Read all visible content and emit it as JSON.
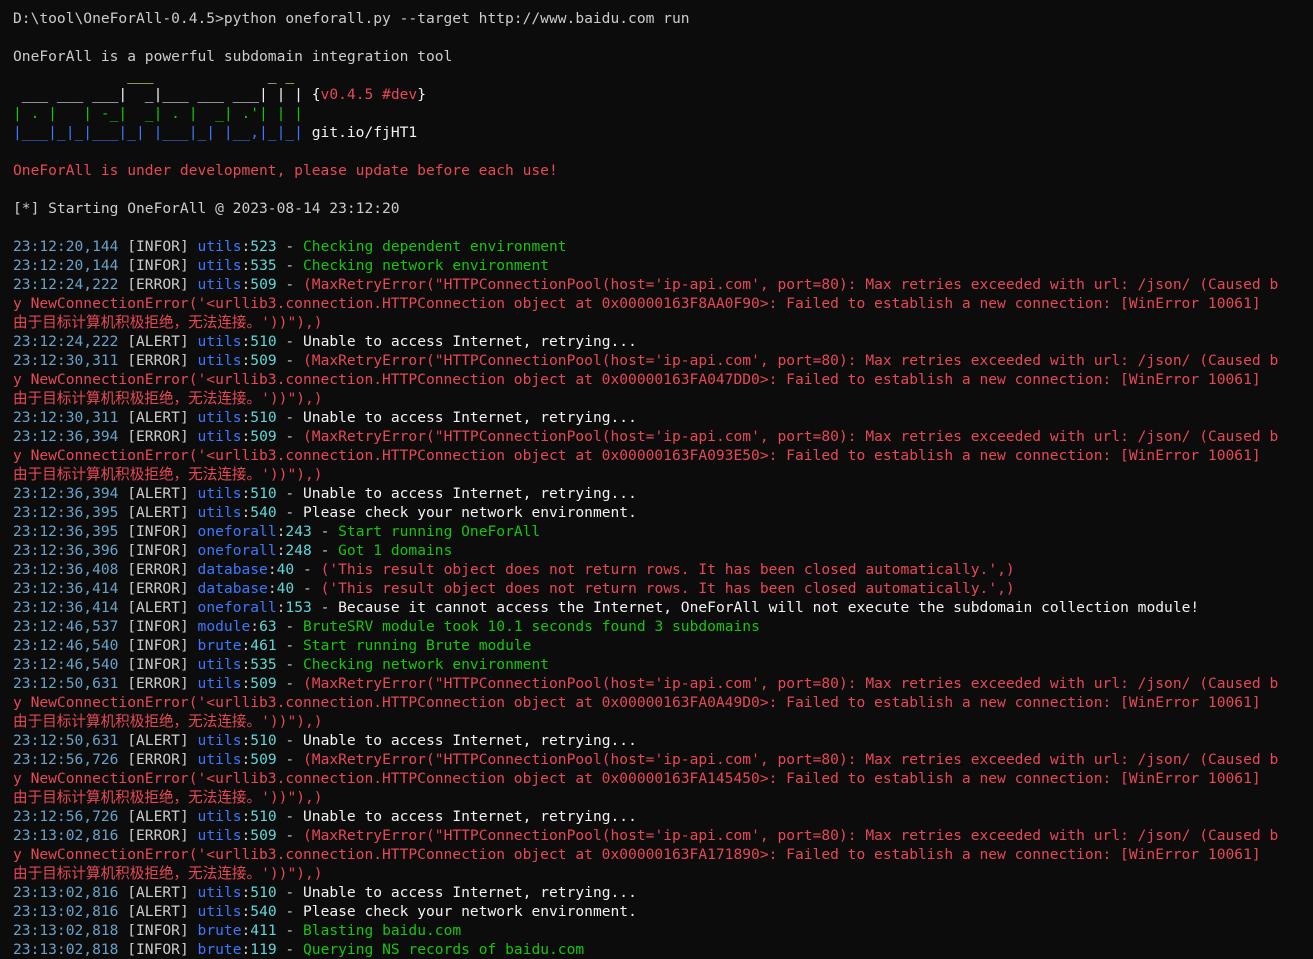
{
  "command_line": "D:\\tool\\OneForAll-0.4.5>python oneforall.py --target http://www.baidu.com run",
  "intro": "OneForAll is a powerful subdomain integration tool",
  "banner": {
    "line1": "             ___             _ _",
    "line2": " ___ ___ ___|  _|___ ___ ___| | |",
    "line3": "| . |   | -_|  _| . |  _| .'| | |",
    "line4": "|___|_|_|___|_| |___|_| |__,|_|_|",
    "version_open": "{",
    "version": "v0.4.5 #dev",
    "version_close": "}",
    "link": "git.io/fjHT1"
  },
  "dev_warning": "OneForAll is under development, please update before each use!",
  "start_line": "[*] Starting OneForAll @ 2023-08-14 23:12:20",
  "colors": {
    "background": "#0c0c0c",
    "info": "#16c60c",
    "error": "#e74856",
    "module": "#3b78ff",
    "banner_green": "#16c60c",
    "banner_yellow": "#f9f1a5",
    "banner_blue": "#3b78ff"
  },
  "log": [
    {
      "t": "23:12:20,144",
      "l": "[INFOR]",
      "m": "utils",
      "n": "523",
      "type": "info",
      "msg": "Checking dependent environment"
    },
    {
      "t": "23:12:20,144",
      "l": "[INFOR]",
      "m": "utils",
      "n": "535",
      "type": "info",
      "msg": "Checking network environment"
    },
    {
      "t": "23:12:24,222",
      "l": "[ERROR]",
      "m": "utils",
      "n": "509",
      "type": "err",
      "msg": "(MaxRetryError(\"HTTPConnectionPool(host='ip-api.com', port=80): Max retries exceeded with url: /json/ (Caused b",
      "cont": [
        "y NewConnectionError('<urllib3.connection.HTTPConnection object at 0x00000163F8AA0F90>: Failed to establish a new connection: [WinError 10061]",
        "由于目标计算机积极拒绝，无法连接。'))\"),)"
      ]
    },
    {
      "t": "23:12:24,222",
      "l": "[ALERT]",
      "m": "utils",
      "n": "510",
      "type": "alert",
      "msg": "Unable to access Internet, retrying..."
    },
    {
      "t": "23:12:30,311",
      "l": "[ERROR]",
      "m": "utils",
      "n": "509",
      "type": "err",
      "msg": "(MaxRetryError(\"HTTPConnectionPool(host='ip-api.com', port=80): Max retries exceeded with url: /json/ (Caused b",
      "cont": [
        "y NewConnectionError('<urllib3.connection.HTTPConnection object at 0x00000163FA047DD0>: Failed to establish a new connection: [WinError 10061]",
        "由于目标计算机积极拒绝，无法连接。'))\"),)"
      ]
    },
    {
      "t": "23:12:30,311",
      "l": "[ALERT]",
      "m": "utils",
      "n": "510",
      "type": "alert",
      "msg": "Unable to access Internet, retrying..."
    },
    {
      "t": "23:12:36,394",
      "l": "[ERROR]",
      "m": "utils",
      "n": "509",
      "type": "err",
      "msg": "(MaxRetryError(\"HTTPConnectionPool(host='ip-api.com', port=80): Max retries exceeded with url: /json/ (Caused b",
      "cont": [
        "y NewConnectionError('<urllib3.connection.HTTPConnection object at 0x00000163FA093E50>: Failed to establish a new connection: [WinError 10061]",
        "由于目标计算机积极拒绝，无法连接。'))\"),)"
      ]
    },
    {
      "t": "23:12:36,394",
      "l": "[ALERT]",
      "m": "utils",
      "n": "510",
      "type": "alert",
      "msg": "Unable to access Internet, retrying..."
    },
    {
      "t": "23:12:36,395",
      "l": "[ALERT]",
      "m": "utils",
      "n": "540",
      "type": "alert",
      "msg": "Please check your network environment."
    },
    {
      "t": "23:12:36,395",
      "l": "[INFOR]",
      "m": "oneforall",
      "n": "243",
      "type": "info",
      "msg": "Start running OneForAll"
    },
    {
      "t": "23:12:36,396",
      "l": "[INFOR]",
      "m": "oneforall",
      "n": "248",
      "type": "info",
      "msg": "Got 1 domains"
    },
    {
      "t": "23:12:36,408",
      "l": "[ERROR]",
      "m": "database",
      "n": "40",
      "type": "err",
      "msg": "('This result object does not return rows. It has been closed automatically.',)"
    },
    {
      "t": "23:12:36,414",
      "l": "[ERROR]",
      "m": "database",
      "n": "40",
      "type": "err",
      "msg": "('This result object does not return rows. It has been closed automatically.',)"
    },
    {
      "t": "23:12:36,414",
      "l": "[ALERT]",
      "m": "oneforall",
      "n": "153",
      "type": "alert",
      "msg": "Because it cannot access the Internet, OneForAll will not execute the subdomain collection module!"
    },
    {
      "t": "23:12:46,537",
      "l": "[INFOR]",
      "m": "module",
      "n": "63",
      "type": "info",
      "msg": "BruteSRV module took 10.1 seconds found 3 subdomains"
    },
    {
      "t": "23:12:46,540",
      "l": "[INFOR]",
      "m": "brute",
      "n": "461",
      "type": "info",
      "msg": "Start running Brute module"
    },
    {
      "t": "23:12:46,540",
      "l": "[INFOR]",
      "m": "utils",
      "n": "535",
      "type": "info",
      "msg": "Checking network environment"
    },
    {
      "t": "23:12:50,631",
      "l": "[ERROR]",
      "m": "utils",
      "n": "509",
      "type": "err",
      "msg": "(MaxRetryError(\"HTTPConnectionPool(host='ip-api.com', port=80): Max retries exceeded with url: /json/ (Caused b",
      "cont": [
        "y NewConnectionError('<urllib3.connection.HTTPConnection object at 0x00000163FA0A49D0>: Failed to establish a new connection: [WinError 10061]",
        "由于目标计算机积极拒绝，无法连接。'))\"),)"
      ]
    },
    {
      "t": "23:12:50,631",
      "l": "[ALERT]",
      "m": "utils",
      "n": "510",
      "type": "alert",
      "msg": "Unable to access Internet, retrying..."
    },
    {
      "t": "23:12:56,726",
      "l": "[ERROR]",
      "m": "utils",
      "n": "509",
      "type": "err",
      "msg": "(MaxRetryError(\"HTTPConnectionPool(host='ip-api.com', port=80): Max retries exceeded with url: /json/ (Caused b",
      "cont": [
        "y NewConnectionError('<urllib3.connection.HTTPConnection object at 0x00000163FA145450>: Failed to establish a new connection: [WinError 10061]",
        "由于目标计算机积极拒绝，无法连接。'))\"),)"
      ]
    },
    {
      "t": "23:12:56,726",
      "l": "[ALERT]",
      "m": "utils",
      "n": "510",
      "type": "alert",
      "msg": "Unable to access Internet, retrying..."
    },
    {
      "t": "23:13:02,816",
      "l": "[ERROR]",
      "m": "utils",
      "n": "509",
      "type": "err",
      "msg": "(MaxRetryError(\"HTTPConnectionPool(host='ip-api.com', port=80): Max retries exceeded with url: /json/ (Caused b",
      "cont": [
        "y NewConnectionError('<urllib3.connection.HTTPConnection object at 0x00000163FA171890>: Failed to establish a new connection: [WinError 10061]",
        "由于目标计算机积极拒绝，无法连接。'))\"),)"
      ]
    },
    {
      "t": "23:13:02,816",
      "l": "[ALERT]",
      "m": "utils",
      "n": "510",
      "type": "alert",
      "msg": "Unable to access Internet, retrying..."
    },
    {
      "t": "23:13:02,816",
      "l": "[ALERT]",
      "m": "utils",
      "n": "540",
      "type": "alert",
      "msg": "Please check your network environment."
    },
    {
      "t": "23:13:02,818",
      "l": "[INFOR]",
      "m": "brute",
      "n": "411",
      "type": "info",
      "msg": "Blasting baidu.com"
    },
    {
      "t": "23:13:02,818",
      "l": "[INFOR]",
      "m": "brute",
      "n": "119",
      "type": "info",
      "msg": "Querying NS records of baidu.com"
    }
  ]
}
